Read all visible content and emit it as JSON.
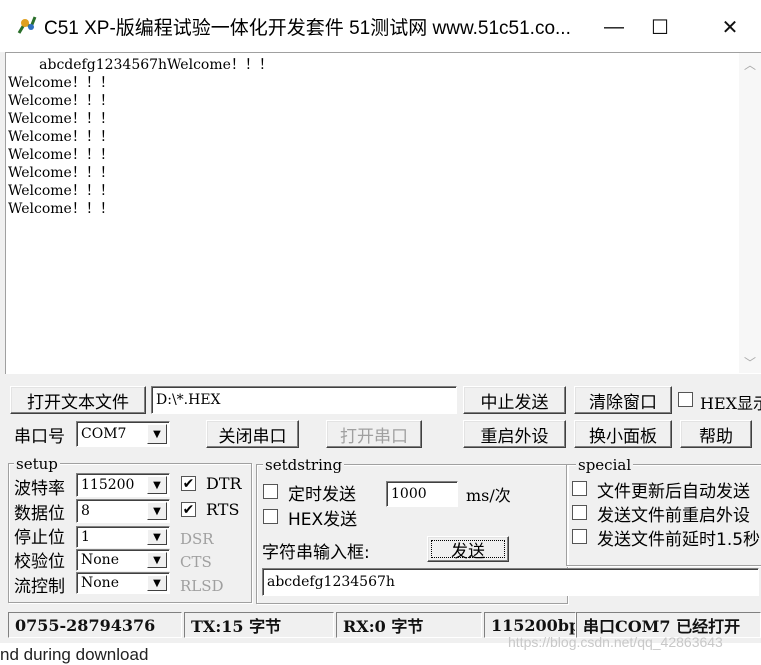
{
  "window": {
    "title": "C51 XP-版编程试验一体化开发套件 51测试网 www.51c51.co...",
    "minimize_glyph": "—",
    "maximize_glyph": "☐",
    "close_glyph": "✕"
  },
  "receive": {
    "text": "       abcdefg1234567hWelcome！！！\nWelcome！！！\nWelcome！！！\nWelcome！！！\nWelcome！！！\nWelcome！！！\nWelcome！！！\nWelcome！！！\nWelcome！！！"
  },
  "toolbar": {
    "open_file_label": "打开文本文件",
    "file_path": "D:\\*.HEX",
    "stop_send_label": "中止发送",
    "clear_window_label": "清除窗口",
    "hex_display_label": "HEX显示",
    "port_label": "串口号",
    "port_value": "COM7",
    "close_port_label": "关闭串口",
    "open_port_label": "打开串口",
    "restart_label": "重启外设",
    "switch_panel_label": "换小面板",
    "help_label": "帮助"
  },
  "setup": {
    "title": "setup",
    "baud_label": "波特率",
    "baud_value": "115200",
    "databits_label": "数据位",
    "databits_value": "8",
    "stopbits_label": "停止位",
    "stopbits_value": "1",
    "parity_label": "校验位",
    "parity_value": "None",
    "flow_label": "流控制",
    "flow_value": "None",
    "dtr_label": "DTR",
    "dtr_checked": "✔",
    "rts_label": "RTS",
    "rts_checked": "✔",
    "dsr_label": "DSR",
    "cts_label": "CTS",
    "rlsd_label": "RLSD"
  },
  "setdstring": {
    "title": "setdstring",
    "timed_send_label": "定时发送",
    "interval_value": "1000",
    "interval_unit": "ms/次",
    "hex_send_label": "HEX发送",
    "input_label": "字符串输入框:",
    "send_label": "发送",
    "input_value": "abcdefg1234567h"
  },
  "special": {
    "title": "special",
    "option1": "文件更新后自动发送",
    "option2": "发送文件前重启外设",
    "option3": "发送文件前延时1.5秒"
  },
  "status": {
    "phone": "0755-28794376",
    "tx": "TX:15 字节",
    "rx": "RX:0 字节",
    "baud": "115200bp",
    "port_state": "串口COM7 已经打开"
  },
  "background": {
    "bottom_text": "nd during download",
    "watermark": "https://blog.csdn.net/qq_42863643"
  }
}
